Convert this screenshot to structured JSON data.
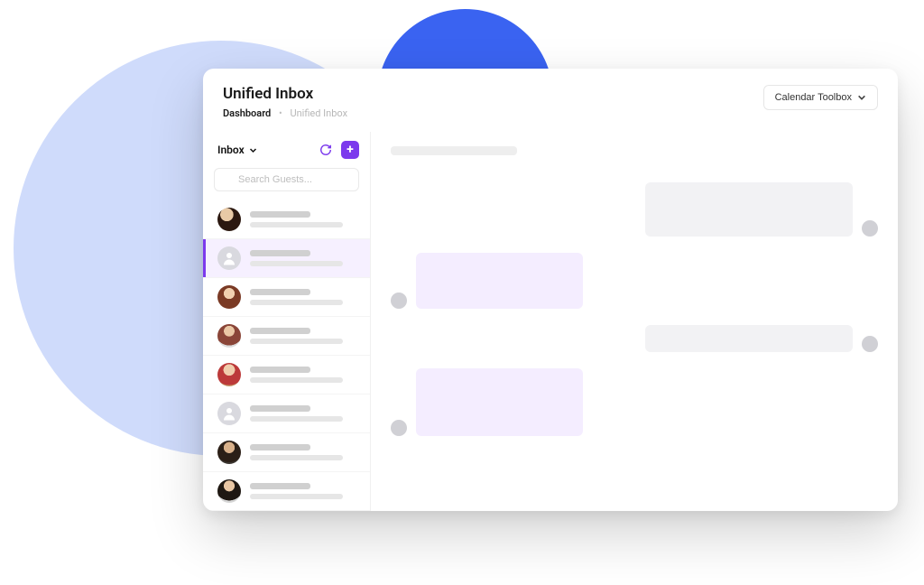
{
  "page": {
    "title": "Unified Inbox"
  },
  "breadcrumb": {
    "root": "Dashboard",
    "separator": "•",
    "current": "Unified Inbox"
  },
  "toolbox": {
    "label": "Calendar Toolbox"
  },
  "sidebar": {
    "folder_label": "Inbox",
    "search_placeholder": "Search Guests...",
    "selected_index": 1,
    "contacts": [
      {
        "avatar_kind": "photo",
        "avatar_class": "av1"
      },
      {
        "avatar_kind": "generic"
      },
      {
        "avatar_kind": "photo",
        "avatar_class": "av2"
      },
      {
        "avatar_kind": "photo",
        "avatar_class": "av3"
      },
      {
        "avatar_kind": "photo",
        "avatar_class": "av4"
      },
      {
        "avatar_kind": "generic"
      },
      {
        "avatar_kind": "photo",
        "avatar_class": "av5"
      },
      {
        "avatar_kind": "photo",
        "avatar_class": "av6"
      }
    ]
  },
  "chat": {
    "messages": [
      {
        "side": "right",
        "style": "grey",
        "size": "b1"
      },
      {
        "side": "left",
        "style": "purple",
        "size": "b2"
      },
      {
        "side": "right",
        "style": "grey",
        "size": "b3"
      },
      {
        "side": "left",
        "style": "purple",
        "size": "b4"
      }
    ]
  },
  "colors": {
    "accent": "#7c3aed",
    "bg_circle_large": "#cfdbfb",
    "bg_circle_small": "#3a63f1"
  }
}
